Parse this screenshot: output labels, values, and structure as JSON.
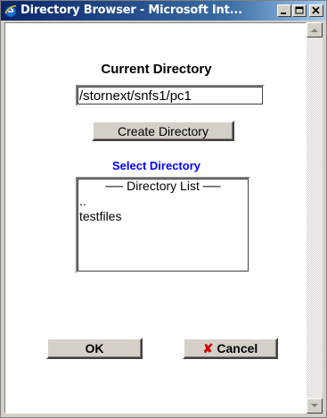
{
  "window": {
    "title": "Directory Browser - Microsoft Int...",
    "icon": "ie-icon",
    "controls": [
      "minimize-icon",
      "maximize-icon",
      "close-icon"
    ]
  },
  "main": {
    "heading": "Current Directory",
    "path_value": "/stornext/snfs1/pc1",
    "create_button": "Create Directory",
    "select_label": "Select Directory",
    "directory_list": {
      "header": "Directory List",
      "items": [
        "..",
        "testfiles"
      ]
    },
    "ok_button": "OK",
    "cancel_button": "Cancel"
  },
  "colors": {
    "select_label": "#0000ff",
    "cancel_icon": "#d00000",
    "titlebar_start": "#0a246a"
  }
}
